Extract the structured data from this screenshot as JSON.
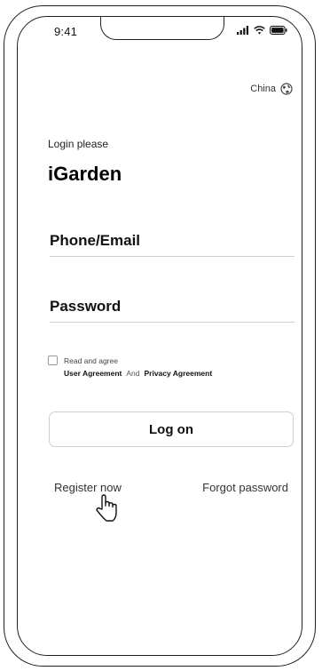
{
  "status_bar": {
    "time": "9:41",
    "icons": [
      "signal-icon",
      "wifi-icon",
      "battery-icon"
    ]
  },
  "header": {
    "country": "China",
    "country_icon": "globe-icon"
  },
  "login": {
    "prompt": "Login please",
    "brand": "iGarden",
    "phone_placeholder": "Phone/Email",
    "password_placeholder": "Password",
    "agree_text": "Read and agree",
    "user_agreement": "User Agreement",
    "and_text": "And",
    "privacy_agreement": "Privacy Agreement",
    "logon_label": "Log on",
    "register_label": "Register now",
    "forgot_label": "Forgot password"
  },
  "colors": {
    "stroke": "#222222",
    "divider": "#cfcfcf",
    "text": "#111111"
  }
}
